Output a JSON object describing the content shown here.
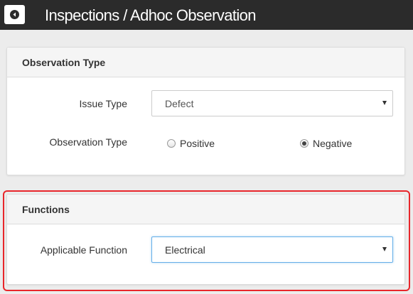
{
  "header": {
    "title": "Inspections / Adhoc Observation",
    "back_icon": "back-circle-icon"
  },
  "observation_panel": {
    "title": "Observation Type",
    "issue_type": {
      "label": "Issue Type",
      "value": "Defect"
    },
    "observation_type": {
      "label": "Observation Type",
      "options": [
        {
          "label": "Positive",
          "checked": false
        },
        {
          "label": "Negative",
          "checked": true
        }
      ]
    }
  },
  "functions_panel": {
    "title": "Functions",
    "applicable_function": {
      "label": "Applicable Function",
      "value": "Electrical"
    }
  },
  "colors": {
    "topbar": "#2b2b2b",
    "highlight": "#e8262b",
    "focus": "#66afe9"
  }
}
